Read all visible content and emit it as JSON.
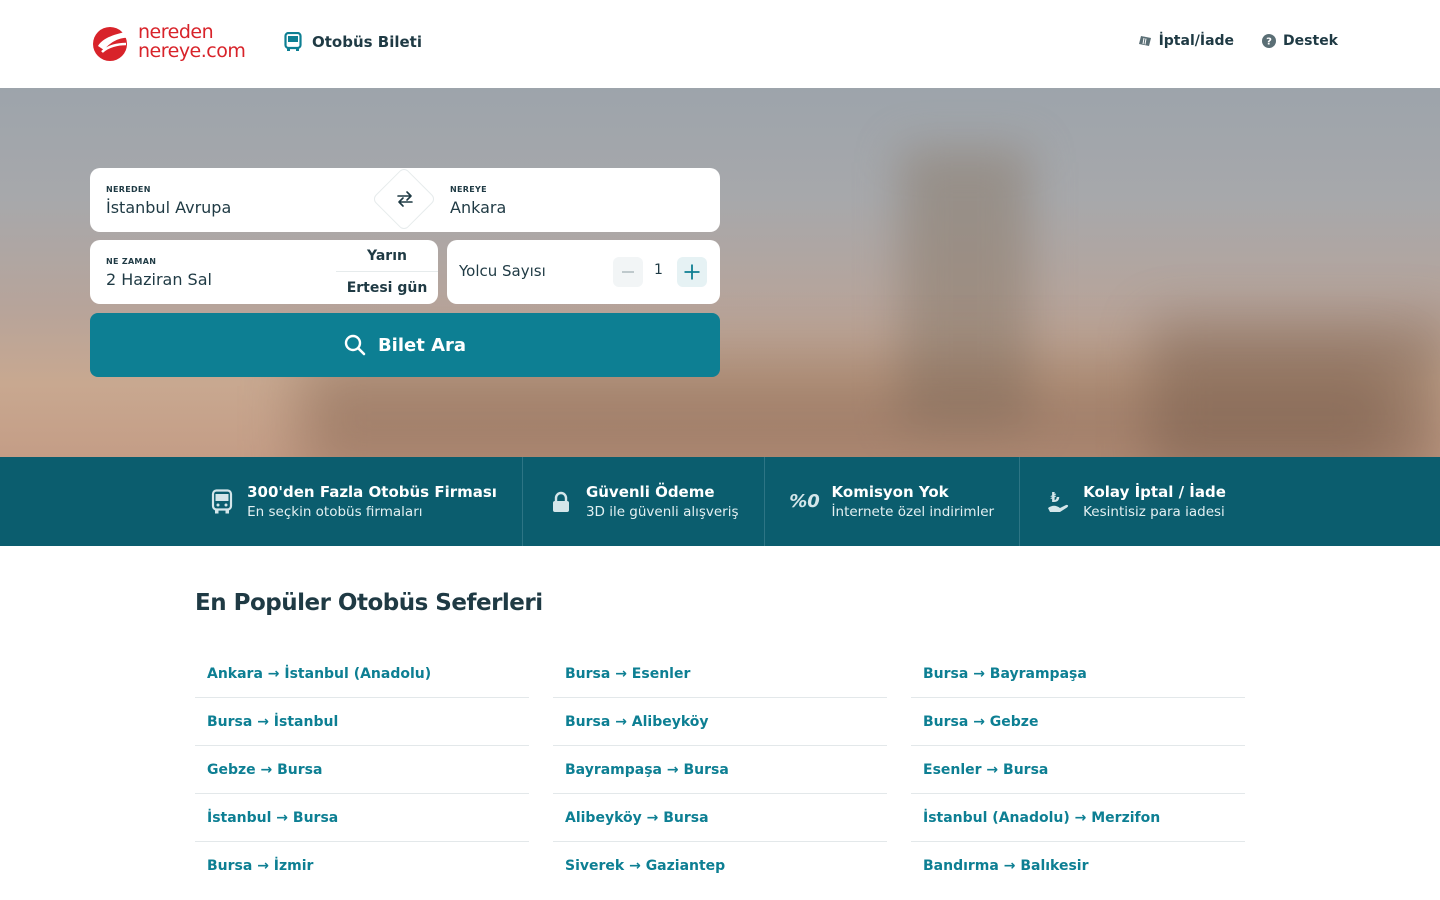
{
  "header": {
    "logo": {
      "line1": "nereden",
      "line2": "nereye.com"
    },
    "product": {
      "label": "Otobüs Bileti",
      "icon": "bus-icon"
    },
    "links": [
      {
        "label": "İptal/İade",
        "icon": "ticket-icon"
      },
      {
        "label": "Destek",
        "icon": "help-icon"
      }
    ]
  },
  "search": {
    "from": {
      "label": "NEREDEN",
      "value": "İstanbul Avrupa"
    },
    "to": {
      "label": "NEREYE",
      "value": "Ankara"
    },
    "date": {
      "label": "NE ZAMAN",
      "value": "2 Haziran Sal"
    },
    "quick_dates": [
      "Yarın",
      "Ertesi gün"
    ],
    "passengers": {
      "label": "Yolcu Sayısı",
      "count": "1"
    },
    "button_label": "Bilet Ara"
  },
  "features": [
    {
      "title": "300'den Fazla Otobüs Firması",
      "subtitle": "En seçkin otobüs firmaları",
      "icon": "bus-icon"
    },
    {
      "title": "Güvenli Ödeme",
      "subtitle": "3D ile güvenli alışveriş",
      "icon": "lock-icon"
    },
    {
      "title": "Komisyon Yok",
      "subtitle": "İnternete özel indirimler",
      "icon": "percent-zero-icon",
      "icon_text": "%0"
    },
    {
      "title": "Kolay İptal / İade",
      "subtitle": "Kesintisiz para iadesi",
      "icon": "refund-icon"
    }
  ],
  "popular": {
    "title": "En Popüler Otobüs Seferleri",
    "columns": [
      [
        "Ankara → İstanbul (Anadolu)",
        "Bursa → İstanbul",
        "Gebze → Bursa",
        "İstanbul → Bursa",
        "Bursa → İzmir"
      ],
      [
        "Bursa → Esenler",
        "Bursa → Alibeyköy",
        "Bayrampaşa → Bursa",
        "Alibeyköy → Bursa",
        "Siverek → Gaziantep"
      ],
      [
        "Bursa → Bayrampaşa",
        "Bursa → Gebze",
        "Esenler → Bursa",
        "İstanbul (Anadolu) → Merzifon",
        "Bandırma → Balıkesir"
      ]
    ]
  },
  "colors": {
    "brand_red": "#d8232a",
    "primary_teal": "#0d7f93",
    "feature_band": "#0b5d6e",
    "text_dark": "#1f3a44"
  }
}
